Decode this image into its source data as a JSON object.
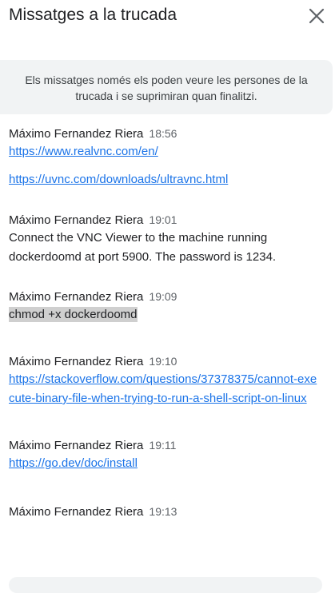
{
  "header": {
    "title": "Missatges a la trucada",
    "close_icon": "close-icon"
  },
  "notice": {
    "text": "Els missatges només els poden veure les persones de la trucada i se suprimiran quan finalitzi."
  },
  "messages": [
    {
      "sender": "Máximo Fernandez Riera",
      "time": "18:56",
      "lines": [
        {
          "type": "link",
          "text": "https://www.realvnc.com/en/"
        },
        {
          "type": "link",
          "text": "https://uvnc.com/downloads/ultravnc.html"
        }
      ]
    },
    {
      "sender": "Máximo Fernandez Riera",
      "time": "19:01",
      "lines": [
        {
          "type": "text",
          "text": "Connect the VNC Viewer to the machine running dockerdoomd at port 5900. The password is 1234."
        }
      ]
    },
    {
      "sender": "Máximo Fernandez Riera",
      "time": "19:09",
      "lines": [
        {
          "type": "highlight",
          "text": "chmod +x dockerdoomd"
        }
      ]
    },
    {
      "sender": "Máximo Fernandez Riera",
      "time": "19:10",
      "lines": [
        {
          "type": "link",
          "text": "https://stackoverflow.com/questions/37378375/cannot-execute-binary-file-when-trying-to-run-a-shell-script-on-linux"
        }
      ]
    },
    {
      "sender": "Máximo Fernandez Riera",
      "time": "19:11",
      "lines": [
        {
          "type": "link",
          "text": "https://go.dev/doc/install"
        }
      ]
    },
    {
      "sender": "Máximo Fernandez Riera",
      "time": "19:13",
      "lines": []
    }
  ]
}
